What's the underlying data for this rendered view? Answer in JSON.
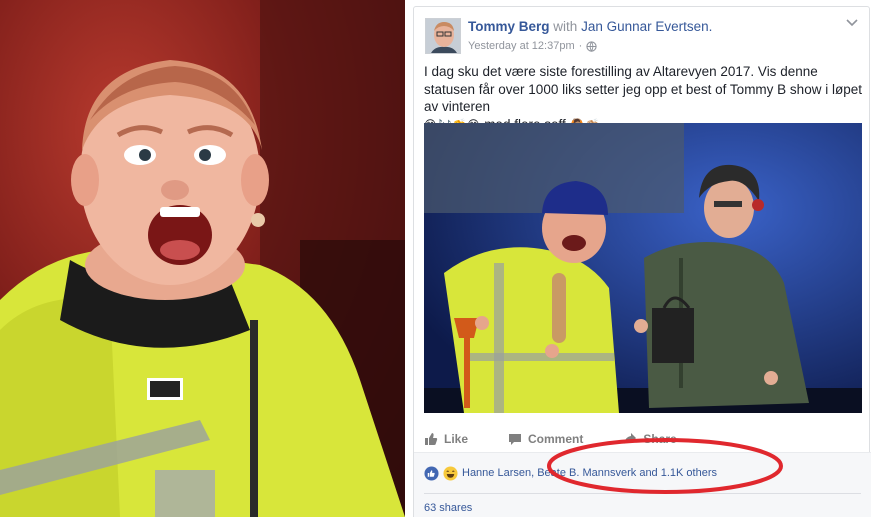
{
  "post": {
    "author": "Tommy Berg",
    "with_label": "with",
    "tagged": "Jan Gunnar Evertsen.",
    "timestamp": "Yesterday at 12:37pm",
    "separator": "·",
    "text": "I dag sku det være siste forestilling av Altarevyen 2017. Vis denne statusen får over 1000 liks setter jeg opp et best of Tommy B show i løpet av vinteren",
    "emoji_line_1": "😊🎶👏😂",
    "emoji_trail_text": "med flere seff",
    "emoji_line_2": "🙆🏽👏🏼"
  },
  "actions": {
    "like": "Like",
    "comment": "Comment",
    "share": "Share"
  },
  "reactions": {
    "names": "Hanne Larsen, Beate B. Mannsverk and 1.1K others",
    "shares": "63 shares"
  },
  "icons": {
    "globe": "globe-icon",
    "chevron": "chevron-down-icon",
    "like": "thumbs-up-icon",
    "comment": "comment-icon",
    "share": "share-arrow-icon",
    "reaction_like": "like-reaction-icon",
    "reaction_haha": "haha-reaction-icon"
  },
  "colors": {
    "link": "#365899",
    "meta": "#90949c",
    "text": "#1d2129",
    "annotation": "#e0282e",
    "like_blue": "#4267b2"
  }
}
